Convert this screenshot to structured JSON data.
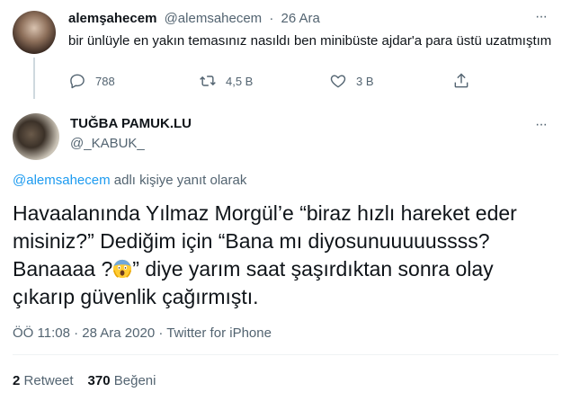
{
  "reply_tweet": {
    "display_name": "alemşahecem",
    "handle": "@alemsahecem",
    "separator": "·",
    "date": "26 Ara",
    "more": "···",
    "text": "bir ünlüyle en yakın temasınız nasıldı ben minibüste ajdar'a para üstü uzatmıştım",
    "actions": {
      "replies": "788",
      "retweets": "4,5 B",
      "likes": "3 B"
    }
  },
  "main_tweet": {
    "display_name": "TUĞBA PAMUK.LU",
    "handle": "@_KABUK_",
    "more": "···",
    "replying_mention": "@alemsahecem",
    "replying_suffix": "adlı kişiye yanıt olarak",
    "text_before_emoji": "Havaalanında Yılmaz Morgül’e “biraz hızlı hareket eder misiniz?” Dediğim için “Bana mı diyosunuuuuussss? Banaaaa ?",
    "text_after_emoji": "” diye yarım saat şaşırdıktan sonra olay çıkarıp güvenlik çağırmıştı.",
    "timestamp": "ÖÖ 11:08 · 28 Ara 2020 · Twitter for iPhone",
    "retweet_count": "2",
    "retweet_label": "Retweet",
    "like_count": "370",
    "like_label": "Beğeni"
  },
  "colors": {
    "text": "#0f1419",
    "secondary": "#536471",
    "link": "#1d9bf0",
    "divider": "#eff3f4"
  }
}
